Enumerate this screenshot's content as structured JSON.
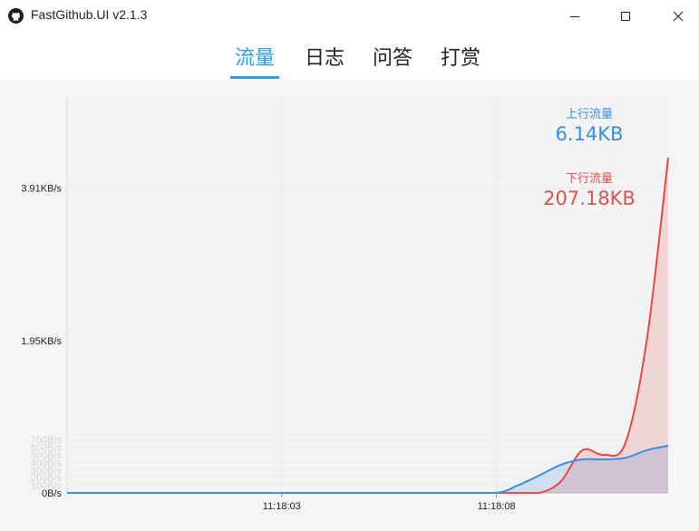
{
  "window": {
    "title": "FastGithub.UI v2.1.3",
    "icon": "github-icon",
    "controls": [
      "minimize-icon",
      "maximize-icon",
      "close-icon"
    ]
  },
  "tabs": [
    {
      "label": "流量",
      "active": true
    },
    {
      "label": "日志",
      "active": false
    },
    {
      "label": "问答",
      "active": false
    },
    {
      "label": "打赏",
      "active": false
    }
  ],
  "stats": {
    "upload_label": "上行流量",
    "upload_value": "6.14KB",
    "download_label": "下行流量",
    "download_value": "207.18KB"
  },
  "colors": {
    "accent": "#2d9ce6",
    "upload": "#3a8ee6",
    "download": "#e64848"
  },
  "chart_data": {
    "type": "area",
    "y_ticks": [
      "0B/s",
      "100B/s",
      "200B/s",
      "300B/s",
      "400B/s",
      "500B/s",
      "600B/s",
      "700B/s",
      "1.95KB/s",
      "3.91KB/s"
    ],
    "x_ticks": [
      "11:18:03",
      "11:18:08"
    ],
    "ylim": [
      0,
      4400
    ],
    "x_range": [
      0,
      14
    ],
    "grid": true,
    "series": [
      {
        "name": "上行流量",
        "x": [
          0,
          1,
          2,
          3,
          4,
          5,
          6,
          7,
          8,
          9,
          10,
          10.5,
          11,
          11.5,
          12,
          12.5,
          13,
          13.5,
          14
        ],
        "values": [
          0,
          0,
          0,
          0,
          0,
          0,
          0,
          0,
          0,
          0,
          0,
          100,
          230,
          370,
          440,
          440,
          460,
          560,
          620
        ]
      },
      {
        "name": "下行流量",
        "x": [
          0,
          1,
          2,
          3,
          4,
          5,
          6,
          7,
          8,
          9,
          10,
          10.5,
          11,
          11.5,
          12,
          12.5,
          13,
          13.5,
          14
        ],
        "values": [
          0,
          0,
          0,
          0,
          0,
          0,
          0,
          0,
          0,
          0,
          0,
          0,
          0,
          150,
          560,
          500,
          650,
          2000,
          4400
        ]
      }
    ]
  }
}
